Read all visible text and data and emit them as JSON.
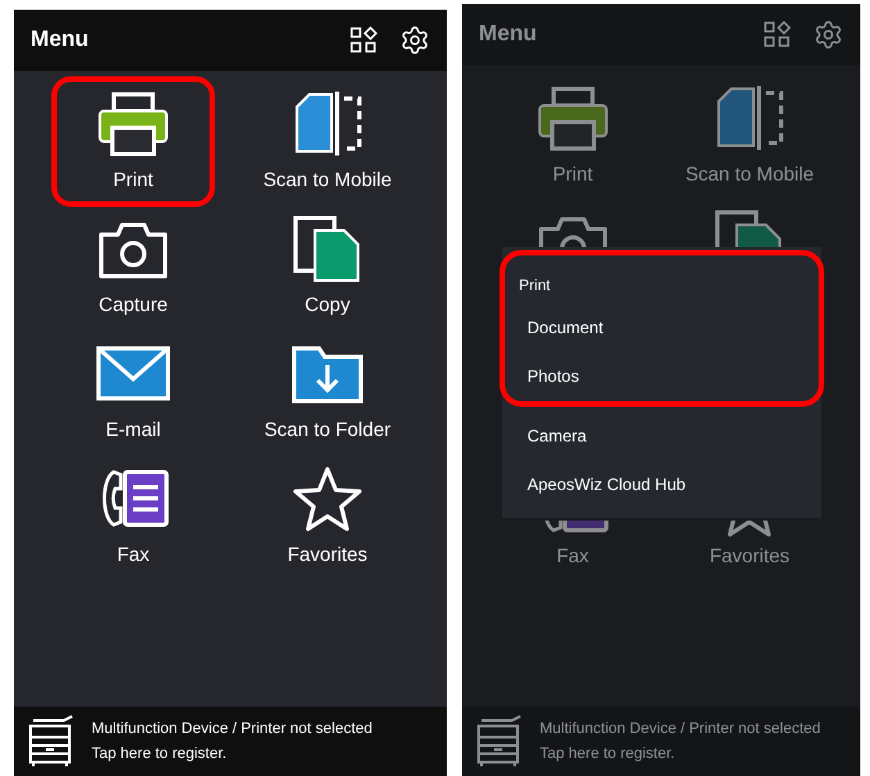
{
  "screens": [
    {
      "dimmed": false,
      "header": {
        "title": "Menu"
      },
      "tiles": [
        {
          "kind": "print",
          "label": "Print",
          "icon_top_hidden": false,
          "icon_bottom_hidden": false,
          "highlighted": true
        },
        {
          "kind": "scan-mobile",
          "label": "Scan to Mobile",
          "icon_top_hidden": false,
          "icon_bottom_hidden": false,
          "highlighted": false
        },
        {
          "kind": "capture",
          "label": "Capture",
          "icon_top_hidden": false,
          "icon_bottom_hidden": false,
          "highlighted": false
        },
        {
          "kind": "copy",
          "label": "Copy",
          "icon_top_hidden": false,
          "icon_bottom_hidden": false,
          "highlighted": false
        },
        {
          "kind": "email",
          "label": "E-mail",
          "icon_top_hidden": false,
          "icon_bottom_hidden": false,
          "highlighted": false
        },
        {
          "kind": "scan-folder",
          "label": "Scan to Folder",
          "icon_top_hidden": false,
          "icon_bottom_hidden": false,
          "highlighted": false
        },
        {
          "kind": "fax",
          "label": "Fax",
          "icon_top_hidden": false,
          "icon_bottom_hidden": false,
          "highlighted": false
        },
        {
          "kind": "favorites",
          "label": "Favorites",
          "icon_top_hidden": false,
          "icon_bottom_hidden": false,
          "highlighted": false
        }
      ],
      "footer": {
        "message": "Multifunction Device / Printer not selected",
        "hint": "Tap here to register."
      }
    },
    {
      "dimmed": true,
      "header": {
        "title": "Menu"
      },
      "tiles": [
        {
          "kind": "print",
          "label": "Print",
          "icon_top_hidden": false,
          "icon_bottom_hidden": false,
          "highlighted": false
        },
        {
          "kind": "scan-mobile",
          "label": "Scan to Mobile",
          "icon_top_hidden": false,
          "icon_bottom_hidden": false,
          "highlighted": false
        },
        {
          "kind": "capture",
          "icon_top_hidden": false,
          "icon_bottom_hidden": true,
          "highlighted": false
        },
        {
          "kind": "copy",
          "icon_top_hidden": false,
          "icon_bottom_hidden": true,
          "highlighted": false
        },
        {
          "kind": "fax",
          "label": "Fax",
          "icon_top_hidden": true,
          "icon_bottom_hidden": false,
          "highlighted": false
        },
        {
          "kind": "favorites",
          "label": "Favorites",
          "icon_top_hidden": true,
          "icon_bottom_hidden": false,
          "highlighted": false
        }
      ],
      "popup": {
        "sections": [
          {
            "title": "Print",
            "highlighted": true,
            "items": [
              "Document",
              "Photos"
            ]
          },
          {
            "highlighted": false,
            "items": [
              "Camera",
              "ApeosWiz Cloud Hub"
            ]
          }
        ]
      },
      "footer": {
        "message": "Multifunction Device / Printer not selected",
        "hint": "Tap here to register."
      }
    }
  ]
}
